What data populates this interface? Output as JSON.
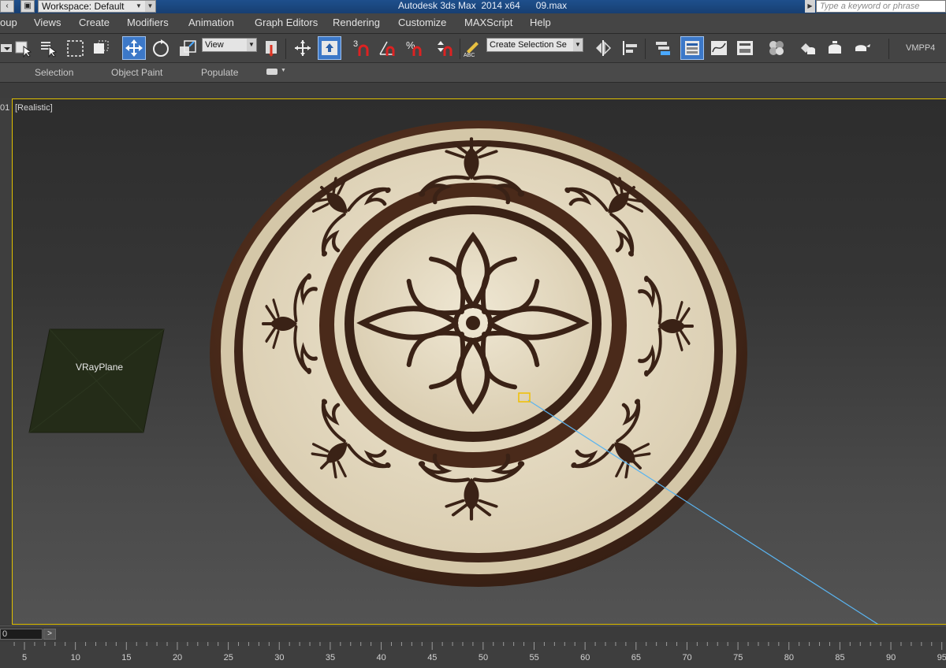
{
  "titlebar": {
    "workspace_label": "Workspace: Default",
    "app_title": "Autodesk 3ds Max  2014 x64      09.max",
    "search_placeholder": "Type a keyword or phrase"
  },
  "menu": {
    "items": [
      "oup",
      "Views",
      "Create",
      "Modifiers",
      "Animation",
      "Graph Editors",
      "Rendering",
      "Customize",
      "MAXScript",
      "Help"
    ]
  },
  "toolbar": {
    "reference_coord": "View",
    "named_selection_placeholder": "Create Selection Se",
    "vmpp_label": "VMPP4"
  },
  "ribbon": {
    "tabs": [
      "Selection",
      "Object Paint",
      "Populate"
    ]
  },
  "viewport": {
    "id_fragment": "01",
    "shading_label": "[Realistic]",
    "object_label": "VRayPlane"
  },
  "timeline": {
    "frame_value": "0",
    "next_label": ">",
    "ticks": [
      "5",
      "10",
      "15",
      "20",
      "25",
      "30",
      "35",
      "40",
      "45",
      "50",
      "55",
      "60",
      "65",
      "70",
      "75",
      "80",
      "85",
      "90",
      "95"
    ]
  },
  "colors": {
    "viewport_border": "#e0c000",
    "active_tool": "#3c78c8",
    "title_bar": "#1e4f8c",
    "light_line": "#5ab4f0",
    "marble_cream": "#e6dcc4",
    "marble_brown": "#4a2a1a"
  }
}
